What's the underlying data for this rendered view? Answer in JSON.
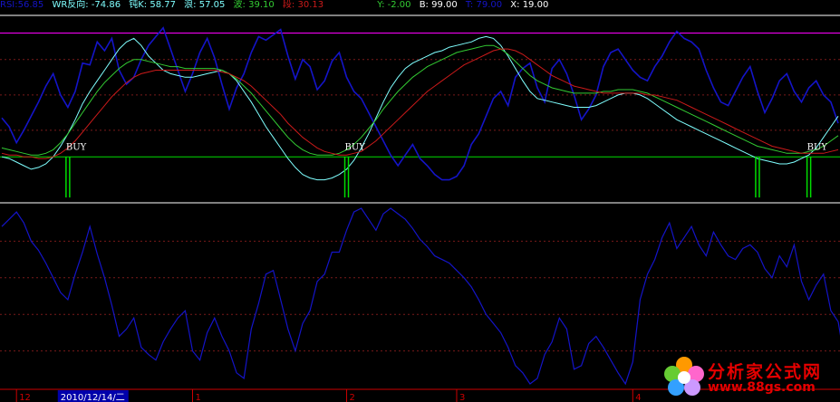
{
  "header": {
    "rsi_label": "RSI:56.85",
    "wr_label": "WR反向: -74.86",
    "kdj_label": "钝K: 58.77",
    "lang_label": "浪: 57.05",
    "bo_label": "波: 39.10",
    "duan_label": "段: 30.13",
    "y_label": "Y: -2.00",
    "b_label": "B: 99.00",
    "t_label": "T: 79.00",
    "x_label": "X: 19.00"
  },
  "colors": {
    "background": "#000000",
    "blue": "#1414c8",
    "cyan": "#7fffff",
    "green": "#33cc33",
    "red": "#cc1a1a",
    "magenta": "#ff00ff",
    "white": "#ffffff",
    "grid_red": "#7a1a1a",
    "signal_green": "#00dd00",
    "date_blue": "#0000aa"
  },
  "x_axis": {
    "date_highlight": "2010/12/14/二",
    "ticks": [
      {
        "label": "12",
        "i": 2
      },
      {
        "label": "1",
        "i": 26
      },
      {
        "label": "2",
        "i": 47
      },
      {
        "label": "3",
        "i": 62
      },
      {
        "label": "4",
        "i": 86
      }
    ]
  },
  "chart_data": [
    {
      "type": "line",
      "panel": "upper",
      "ylim": [
        0,
        105
      ],
      "reference_lines": [
        {
          "name": "magenta_top",
          "value": 95
        },
        {
          "name": "green_base",
          "value": 25
        }
      ],
      "grid": true,
      "n": 115,
      "series": [
        {
          "key": "blue",
          "values": [
            47,
            42,
            33,
            40,
            48,
            56,
            65,
            72,
            60,
            53,
            62,
            78,
            77,
            90,
            85,
            92,
            74,
            66,
            70,
            80,
            88,
            93,
            98,
            86,
            74,
            62,
            72,
            84,
            92,
            81,
            66,
            52,
            64,
            72,
            84,
            93,
            91,
            94,
            97,
            82,
            69,
            80,
            76,
            63,
            68,
            79,
            84,
            70,
            62,
            58,
            50,
            42,
            34,
            26,
            20,
            26,
            32,
            24,
            20,
            15,
            12,
            12,
            14,
            20,
            32,
            38,
            48,
            58,
            62,
            54,
            70,
            75,
            78,
            64,
            56,
            75,
            80,
            72,
            60,
            46,
            52,
            60,
            76,
            84,
            86,
            80,
            74,
            70,
            68,
            76,
            82,
            90,
            96,
            92,
            90,
            86,
            74,
            64,
            56,
            54,
            62,
            70,
            76,
            62,
            50,
            58,
            68,
            72,
            62,
            56,
            64,
            68,
            60,
            56,
            44
          ]
        },
        {
          "key": "cyan",
          "values": [
            25,
            24,
            22,
            20,
            18,
            19,
            21,
            25,
            31,
            38,
            46,
            55,
            62,
            68,
            74,
            80,
            86,
            90,
            92,
            88,
            82,
            78,
            74,
            72,
            71,
            70,
            70,
            71,
            72,
            73,
            74,
            72,
            68,
            62,
            56,
            49,
            42,
            36,
            30,
            24,
            19,
            15,
            13,
            12,
            12,
            13,
            15,
            18,
            23,
            30,
            38,
            47,
            56,
            64,
            70,
            75,
            78,
            80,
            82,
            84,
            85,
            87,
            88,
            89,
            90,
            92,
            93,
            92,
            88,
            82,
            75,
            68,
            62,
            58,
            57,
            56,
            55,
            54,
            53,
            53,
            53,
            54,
            56,
            58,
            60,
            61,
            61,
            60,
            58,
            55,
            52,
            49,
            46,
            44,
            42,
            40,
            38,
            36,
            34,
            32,
            30,
            28,
            26,
            24,
            23,
            22,
            21,
            21,
            22,
            24,
            26,
            30,
            36,
            42,
            48
          ]
        },
        {
          "key": "green",
          "values": [
            30,
            29,
            28,
            27,
            26,
            26,
            27,
            29,
            33,
            38,
            44,
            50,
            56,
            62,
            67,
            71,
            75,
            78,
            80,
            80,
            79,
            78,
            77,
            76,
            76,
            75,
            75,
            75,
            75,
            75,
            74,
            72,
            69,
            65,
            61,
            56,
            51,
            46,
            41,
            36,
            32,
            29,
            27,
            26,
            26,
            26,
            27,
            29,
            32,
            36,
            41,
            46,
            52,
            57,
            62,
            66,
            70,
            73,
            76,
            78,
            80,
            82,
            84,
            85,
            86,
            87,
            88,
            88,
            86,
            83,
            79,
            75,
            71,
            68,
            66,
            64,
            63,
            62,
            61,
            61,
            61,
            61,
            62,
            62,
            63,
            63,
            63,
            62,
            61,
            59,
            57,
            55,
            53,
            51,
            49,
            47,
            45,
            43,
            41,
            39,
            37,
            35,
            33,
            31,
            30,
            29,
            28,
            27,
            27,
            27,
            28,
            29,
            31,
            34,
            37
          ]
        },
        {
          "key": "red",
          "values": [
            27,
            26,
            26,
            25,
            25,
            24,
            24,
            25,
            27,
            30,
            34,
            39,
            44,
            49,
            54,
            59,
            63,
            67,
            70,
            72,
            73,
            74,
            74,
            74,
            74,
            74,
            74,
            74,
            74,
            74,
            73,
            72,
            70,
            68,
            65,
            61,
            57,
            53,
            49,
            44,
            40,
            36,
            33,
            30,
            28,
            27,
            26,
            26,
            27,
            28,
            31,
            34,
            38,
            42,
            46,
            50,
            54,
            58,
            62,
            65,
            68,
            71,
            74,
            77,
            79,
            81,
            83,
            85,
            86,
            86,
            85,
            83,
            80,
            77,
            74,
            71,
            69,
            67,
            65,
            64,
            63,
            62,
            61,
            61,
            61,
            61,
            61,
            61,
            60,
            60,
            59,
            58,
            57,
            55,
            53,
            51,
            49,
            47,
            45,
            43,
            41,
            39,
            37,
            35,
            33,
            31,
            30,
            29,
            28,
            27,
            27,
            27,
            27,
            28,
            29
          ]
        }
      ],
      "signals": [
        {
          "i": 9,
          "label": "BUY"
        },
        {
          "i": 47,
          "label": "BUY"
        },
        {
          "i": 103,
          "label": ""
        },
        {
          "i": 110,
          "label": "BUY"
        }
      ]
    },
    {
      "type": "line",
      "panel": "lower",
      "ylim": [
        0,
        100
      ],
      "grid": true,
      "series": [
        {
          "key": "blue_lower",
          "values": [
            88,
            92,
            96,
            90,
            80,
            75,
            68,
            60,
            52,
            48,
            62,
            74,
            88,
            73,
            60,
            45,
            28,
            32,
            38,
            22,
            18,
            15,
            25,
            32,
            38,
            42,
            20,
            15,
            30,
            38,
            28,
            20,
            8,
            5,
            32,
            46,
            62,
            64,
            48,
            32,
            20,
            35,
            42,
            58,
            62,
            74,
            74,
            86,
            96,
            98,
            92,
            86,
            95,
            98,
            95,
            92,
            87,
            81,
            77,
            72,
            70,
            68,
            64,
            60,
            55,
            48,
            40,
            35,
            30,
            22,
            12,
            8,
            2,
            5,
            18,
            25,
            38,
            32,
            10,
            12,
            24,
            28,
            22,
            15,
            8,
            2,
            14,
            48,
            62,
            70,
            82,
            90,
            76,
            82,
            88,
            78,
            72,
            85,
            78,
            72,
            70,
            76,
            78,
            74,
            65,
            60,
            72,
            66,
            78,
            58,
            48,
            56,
            62,
            42,
            36,
            12
          ]
        }
      ]
    }
  ],
  "watermark": {
    "title": "分析家公式网",
    "url": "www.88gs.com"
  }
}
